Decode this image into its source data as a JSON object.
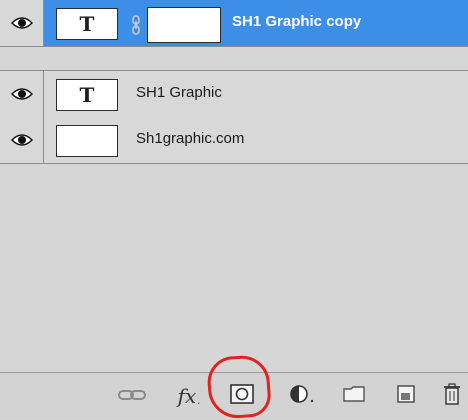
{
  "layers": [
    {
      "name": "SH1 Graphic copy",
      "type": "text",
      "selected": true,
      "has_mask": true,
      "visible": true
    },
    {
      "name": "SH1 Graphic",
      "type": "text",
      "selected": false,
      "has_mask": false,
      "visible": true
    },
    {
      "name": "Sh1graphic.com",
      "type": "raster",
      "selected": false,
      "has_mask": false,
      "visible": true
    }
  ],
  "text_thumb_glyph": "T",
  "footer_buttons": [
    {
      "name": "link-layers-button",
      "icon": "link-icon"
    },
    {
      "name": "add-layer-style-button",
      "icon": "fx-icon",
      "label": "fx"
    },
    {
      "name": "add-layer-mask-button",
      "icon": "layer-mask-icon",
      "highlighted": true
    },
    {
      "name": "new-adjustment-layer-button",
      "icon": "adjustment-icon"
    },
    {
      "name": "new-group-button",
      "icon": "folder-icon"
    },
    {
      "name": "new-layer-button",
      "icon": "new-layer-icon"
    },
    {
      "name": "delete-layer-button",
      "icon": "trash-icon"
    }
  ],
  "colors": {
    "selection": "#3d8ee6",
    "annotation": "#e0231c",
    "panel": "#d6d6d6"
  }
}
